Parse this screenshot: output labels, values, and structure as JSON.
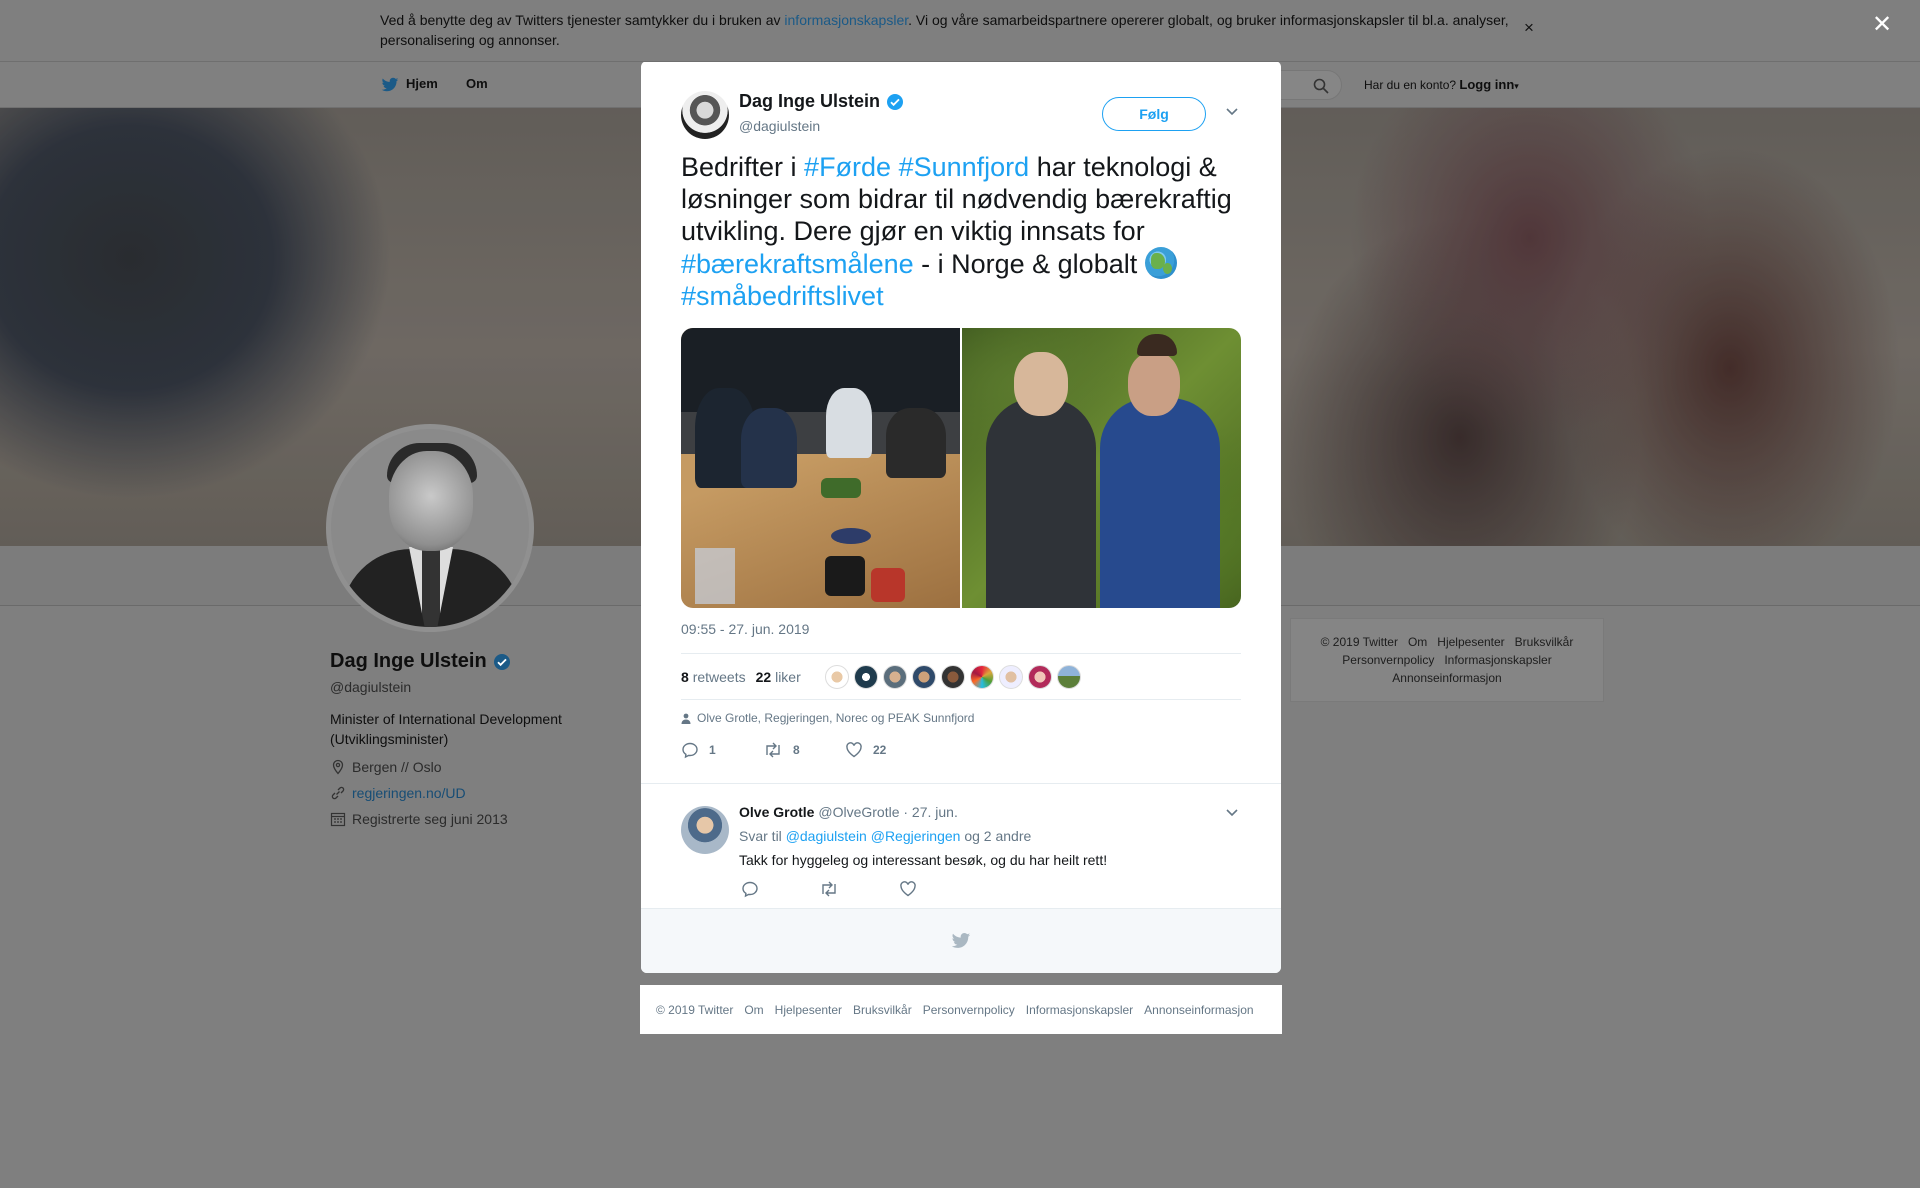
{
  "cookie_banner": {
    "text_before": "Ved å benytte deg av Twitters tjenester samtykker du i bruken av ",
    "link": "informasjonskapsler",
    "text_after": ". Vi og våre samarbeidspartnere opererer globalt, og bruker informasjonskapsler til bl.a. analyser, personalisering og annonser.",
    "close": "×"
  },
  "overlay_close": "✕",
  "nav": {
    "home": "Hjem",
    "about": "Om",
    "login_prompt": "Har du en konto?",
    "login": "Logg inn"
  },
  "profile": {
    "name": "Dag Inge Ulstein",
    "handle": "@dagiulstein",
    "bio": "Minister of International Development (Utviklingsminister)",
    "location": "Bergen // Oslo",
    "website": "regjeringen.no/UD",
    "joined": "Registrerte seg juni 2013"
  },
  "side_footer": [
    "© 2019 Twitter",
    "Om",
    "Hjelpesenter",
    "Bruksvilkår",
    "Personvernpolicy",
    "Informasjonskapsler",
    "Annonseinformasjon"
  ],
  "tweet": {
    "author_name": "Dag Inge Ulstein",
    "author_handle": "@dagiulstein",
    "follow_label": "Følg",
    "text_1": "Bedrifter i ",
    "tag_1": "#Førde",
    "tag_2": "#Sunnfjord",
    "text_2": " har teknologi & løsninger som bidrar til nødvendig bærekraftig utvikling. Dere gjør en viktig innsats for ",
    "tag_3": "#bærekraftsmålene",
    "text_3": " - i Norge & globalt ",
    "tag_4": "#småbedriftslivet",
    "timestamp": "09:55 - 27. jun. 2019",
    "retweets_count": "8",
    "retweets_label": "retweets",
    "likes_count": "22",
    "likes_label": "liker",
    "likers_text": "Olve Grotle, Regjeringen, Norec og PEAK Sunnfjord",
    "reply_count": "1",
    "retweet_count": "8",
    "like_count": "22"
  },
  "reply": {
    "name": "Olve Grotle",
    "handle": "@OlveGrotle",
    "date": "· 27. jun.",
    "reply_to_prefix": "Svar til",
    "mention_1": "@dagiulstein",
    "mention_2": "@Regjeringen",
    "reply_to_suffix": "og 2 andre",
    "text": "Takk for hyggeleg og interessant besøk, og du har heilt rett!"
  },
  "bottom_footer": [
    "© 2019 Twitter",
    "Om",
    "Hjelpesenter",
    "Bruksvilkår",
    "Personvernpolicy",
    "Informasjonskapsler",
    "Annonseinformasjon"
  ],
  "colors": {
    "accent": "#1da1f2",
    "secondary_text": "#657786",
    "overlay": "#7f7f7f"
  }
}
